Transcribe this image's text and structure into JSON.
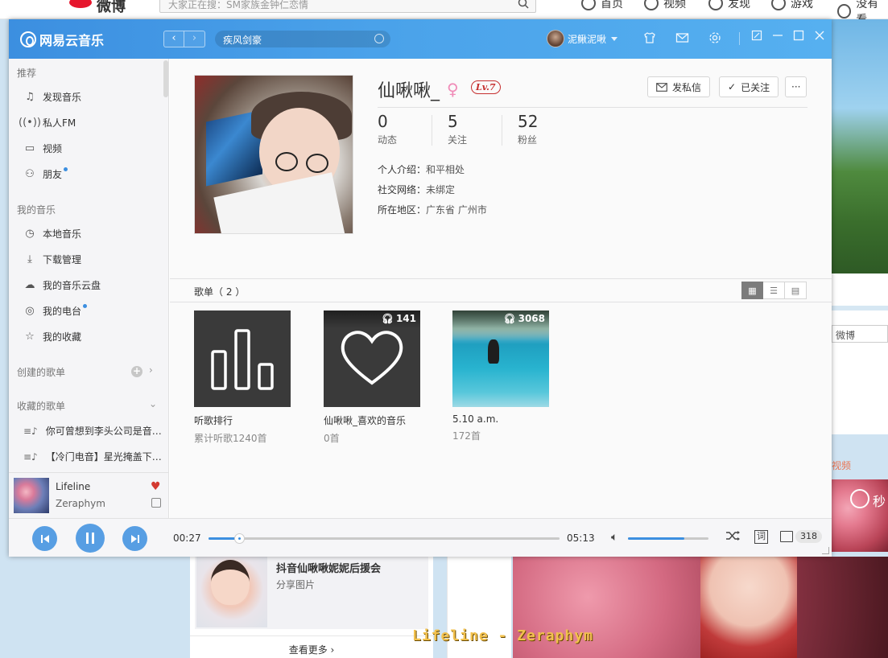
{
  "background_page": {
    "site_logo": "微博",
    "search_placeholder": "大家正在搜：SM家族金钟仁恋情",
    "nav": [
      {
        "label": "首页",
        "icon": "home-icon"
      },
      {
        "label": "视频",
        "icon": "video-icon"
      },
      {
        "label": "发现",
        "icon": "compass-icon"
      },
      {
        "label": "游戏",
        "icon": "gamepad-icon"
      },
      {
        "label": "没有看",
        "icon": "user-icon"
      }
    ],
    "right_input": "微博",
    "right_link": "视频",
    "right_video_logo": "秒",
    "card_title": "抖音仙啾啾妮妮后援会",
    "card_sub": "分享图片",
    "card_more": "查看更多 ›",
    "subtitle": "Lifeline - Zeraphym"
  },
  "app": {
    "title": "网易云音乐",
    "search_value": "疾风剑豪",
    "user_name": "泥鳅泥啾",
    "header_icons": [
      "skin-icon",
      "mail-icon",
      "settings-icon"
    ],
    "window_buttons": [
      "mini-mode-icon",
      "minimize-icon",
      "maximize-icon",
      "close-icon"
    ]
  },
  "sidebar": {
    "sections": {
      "recommend": "推荐",
      "my_music": "我的音乐",
      "created": "创建的歌单",
      "collected": "收藏的歌单"
    },
    "recommend_items": [
      {
        "label": "发现音乐",
        "icon": "music-note-icon",
        "dot": false
      },
      {
        "label": "私人FM",
        "icon": "radio-icon",
        "dot": false
      },
      {
        "label": "视频",
        "icon": "video-icon",
        "dot": false
      },
      {
        "label": "朋友",
        "icon": "friends-icon",
        "dot": true
      }
    ],
    "my_music_items": [
      {
        "label": "本地音乐",
        "icon": "local-music-icon",
        "dot": false
      },
      {
        "label": "下载管理",
        "icon": "download-icon",
        "dot": false
      },
      {
        "label": "我的音乐云盘",
        "icon": "cloud-icon",
        "dot": false
      },
      {
        "label": "我的电台",
        "icon": "podcast-icon",
        "dot": true
      },
      {
        "label": "我的收藏",
        "icon": "collection-icon",
        "dot": false
      }
    ],
    "collected_playlists": [
      "你可曾想到李头公司是音…",
      "【冷门电音】星光掩盖下…"
    ]
  },
  "now_playing": {
    "title": "Lifeline",
    "artist": "Zeraphym",
    "liked": true
  },
  "profile": {
    "name": "仙啾啾_",
    "gender_icon": "female-icon",
    "level": "Lv.7",
    "buttons": {
      "message": "发私信",
      "followed": "已关注",
      "more": "···"
    },
    "stats": [
      {
        "num": "0",
        "label": "动态"
      },
      {
        "num": "5",
        "label": "关注"
      },
      {
        "num": "52",
        "label": "粉丝"
      }
    ],
    "info": [
      {
        "key": "个人介绍：",
        "value": "和平相处"
      },
      {
        "key": "社交网络：",
        "value": "未绑定"
      },
      {
        "key": "所在地区：",
        "value": "广东省 广州市"
      }
    ]
  },
  "playlists": {
    "header": "歌单（ 2 ）",
    "view_modes": [
      "grid-view-icon",
      "list-view-icon",
      "detail-view-icon"
    ],
    "active_view": 0,
    "items": [
      {
        "name": "听歌排行",
        "count": "累计听歌1240首",
        "plays": "",
        "cover": "ranking"
      },
      {
        "name": "仙啾啾_喜欢的音乐",
        "count": "0首",
        "plays": "141",
        "cover": "heart"
      },
      {
        "name": "5.10 a.m.",
        "count": "172首",
        "plays": "3068",
        "cover": "pool"
      }
    ]
  },
  "player": {
    "current_time": "00:27",
    "total_time": "05:13",
    "progress": 0.087,
    "volume": 0.7,
    "lyric_label": "词",
    "playlist_count": "318"
  },
  "colors": {
    "accent": "#3c8fe0",
    "level_red": "#c62f2f",
    "heart_red": "#d33a31"
  }
}
